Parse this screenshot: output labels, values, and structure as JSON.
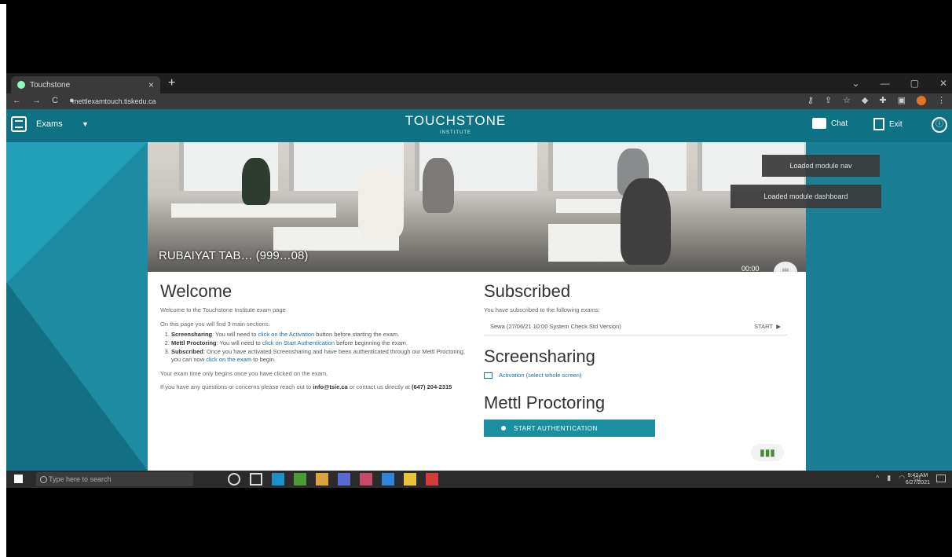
{
  "browser": {
    "tab_title": "Touchstone",
    "tab_close": "×",
    "new_tab": "+",
    "url": "mettlexamtouch.tiskedu.ca",
    "window_controls": [
      "⌄",
      "—",
      "▢",
      "✕"
    ]
  },
  "header": {
    "menu_label": "Exams",
    "brand": "TOUCHSTONE",
    "brand_sub": "INSTITUTE",
    "chat_label": "Chat",
    "exit_label": "Exit",
    "info_icon": "ⓘ"
  },
  "hero": {
    "candidate": "RUBAIYAT TAB… (999…08)",
    "timer": "00:00"
  },
  "welcome": {
    "title": "Welcome",
    "intro": "Welcome to the Touchstone Institute exam page.",
    "sections_intro": "On this page you will find 3 main sections:",
    "steps": [
      {
        "name": "Screensharing",
        "text": ": You will need to ",
        "link": "click on the Activation",
        "after": " button before starting the exam."
      },
      {
        "name": "Mettl Proctoring",
        "text": ": You will need to ",
        "link": "click on Start Authentication",
        "after": " before beginning the exam."
      },
      {
        "name": "Subscribed",
        "text": ": Once you have activated Screensharing and have been authenticated through our Mettl Proctoring, you can now ",
        "link": "click on the exam",
        "after": " to begin."
      }
    ],
    "note": "Your exam time only begins once you have clicked on the exam.",
    "contact": "If you have any questions or concerns please reach out to ",
    "email": "info@tsie.ca",
    "contact_after": " or contact us directly at ",
    "phone": "(647) 204-2315"
  },
  "subscribed": {
    "title": "Subscribed",
    "desc": "You have subscribed to the following exams:",
    "exam_name": "Sewa (27/06/21 10:00 System Check Std Version)",
    "exam_action": "START",
    "exam_arrow": "▶"
  },
  "screensharing": {
    "title": "Screensharing",
    "activation": "Activation (select whole screen)"
  },
  "proctoring": {
    "title": "Mettl Proctoring",
    "button": "START AUTHENTICATION"
  },
  "toasts": {
    "nav": "Loaded module nav",
    "dashboard": "Loaded module dashboard"
  },
  "taskbar": {
    "search_placeholder": "Type here to search",
    "clock_time": "9:42 AM",
    "clock_date": "6/27/2021"
  }
}
